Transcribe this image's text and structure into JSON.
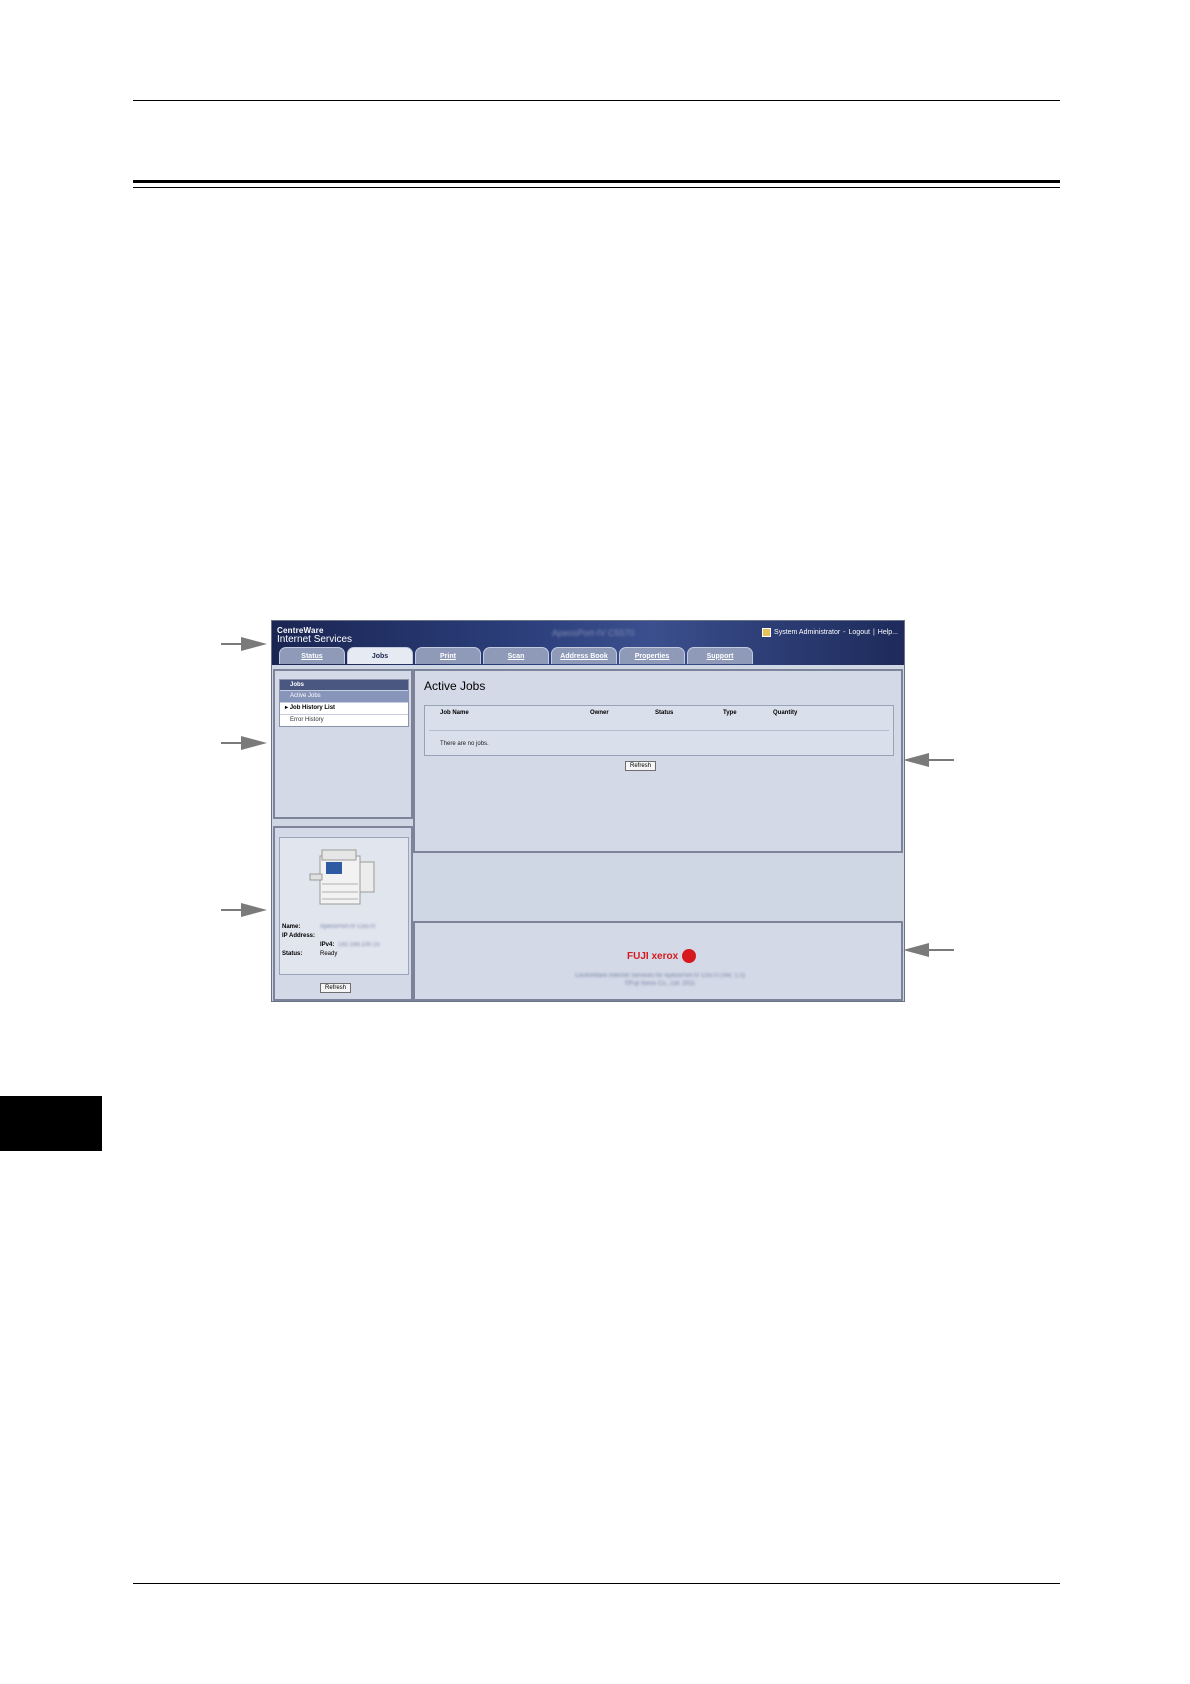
{
  "banner": {
    "brand_top": "CentreWare",
    "brand_bottom": "Internet Services",
    "model": "ApeosPort-IV C5570",
    "user": "System Administrator",
    "separator": "-",
    "logout": "Logout",
    "pipe": "|",
    "help": "Help..."
  },
  "tabs": [
    {
      "label": "Status"
    },
    {
      "label": "Jobs"
    },
    {
      "label": "Print"
    },
    {
      "label": "Scan"
    },
    {
      "label": "Address Book"
    },
    {
      "label": "Properties"
    },
    {
      "label": "Support"
    }
  ],
  "nav": {
    "header": "Jobs",
    "items": [
      {
        "label": "Active Jobs"
      },
      {
        "label": "Job History List"
      },
      {
        "label": "Error History"
      }
    ]
  },
  "main": {
    "title": "Active Jobs",
    "columns": [
      "Job Name",
      "Owner",
      "Status",
      "Type",
      "Quantity"
    ],
    "empty_message": "There are no jobs.",
    "refresh": "Refresh"
  },
  "device": {
    "name_label": "Name:",
    "name_value": "ApeosPort-IV C5570",
    "ip_label": "IP Address:",
    "ipv4_label": "IPv4:",
    "ipv4_value": "192.168.100.15",
    "status_label": "Status:",
    "status_value": "Ready",
    "refresh": "Refresh"
  },
  "footer": {
    "logo": "FUJI xerox",
    "line1": "CentreWare Internet Services for ApeosPort-IV C5570 (Ver. 1.0)",
    "line2": "©Fuji Xerox Co., Ltd. 2011"
  },
  "colors": {
    "banner": "#1a2552",
    "panel": "#d3d9e6",
    "logo": "#d7191f"
  }
}
